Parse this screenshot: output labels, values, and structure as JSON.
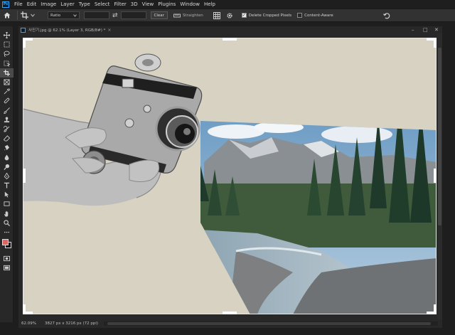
{
  "menubar": {
    "logo_text": "Ps",
    "items": [
      "File",
      "Edit",
      "Image",
      "Layer",
      "Type",
      "Select",
      "Filter",
      "3D",
      "View",
      "Plugins",
      "Window",
      "Help"
    ]
  },
  "options": {
    "ratio_value": "Ratio",
    "clear_label": "Clear",
    "straighten_label": "Straighten",
    "delete_cropped_label": "Delete Cropped Pixels",
    "delete_cropped_checked": true,
    "content_aware_label": "Content-Aware",
    "content_aware_checked": false
  },
  "document": {
    "tab_title": "사진기.jpg @ 62.1% (Layer 3, RGB/8#) *",
    "close_label": "×"
  },
  "status": {
    "zoom": "62.09%",
    "dimensions": "3827 px x 3216 px (72 ppi)",
    "arrow": "›"
  },
  "colors": {
    "foreground": "#e06464",
    "background": "#111111",
    "canvas_bg": "#d8d2c3",
    "accent": "#31a8ff"
  },
  "tool_icons": [
    "move-icon",
    "marquee-icon",
    "lasso-icon",
    "object-select-icon",
    "crop-icon",
    "frame-icon",
    "eyedropper-icon",
    "healing-icon",
    "brush-icon",
    "stamp-icon",
    "history-brush-icon",
    "eraser-icon",
    "gradient-icon",
    "blur-icon",
    "dodge-icon",
    "pen-icon",
    "type-icon",
    "path-select-icon",
    "rectangle-icon",
    "hand-icon",
    "zoom-icon",
    "more-tools-icon"
  ]
}
